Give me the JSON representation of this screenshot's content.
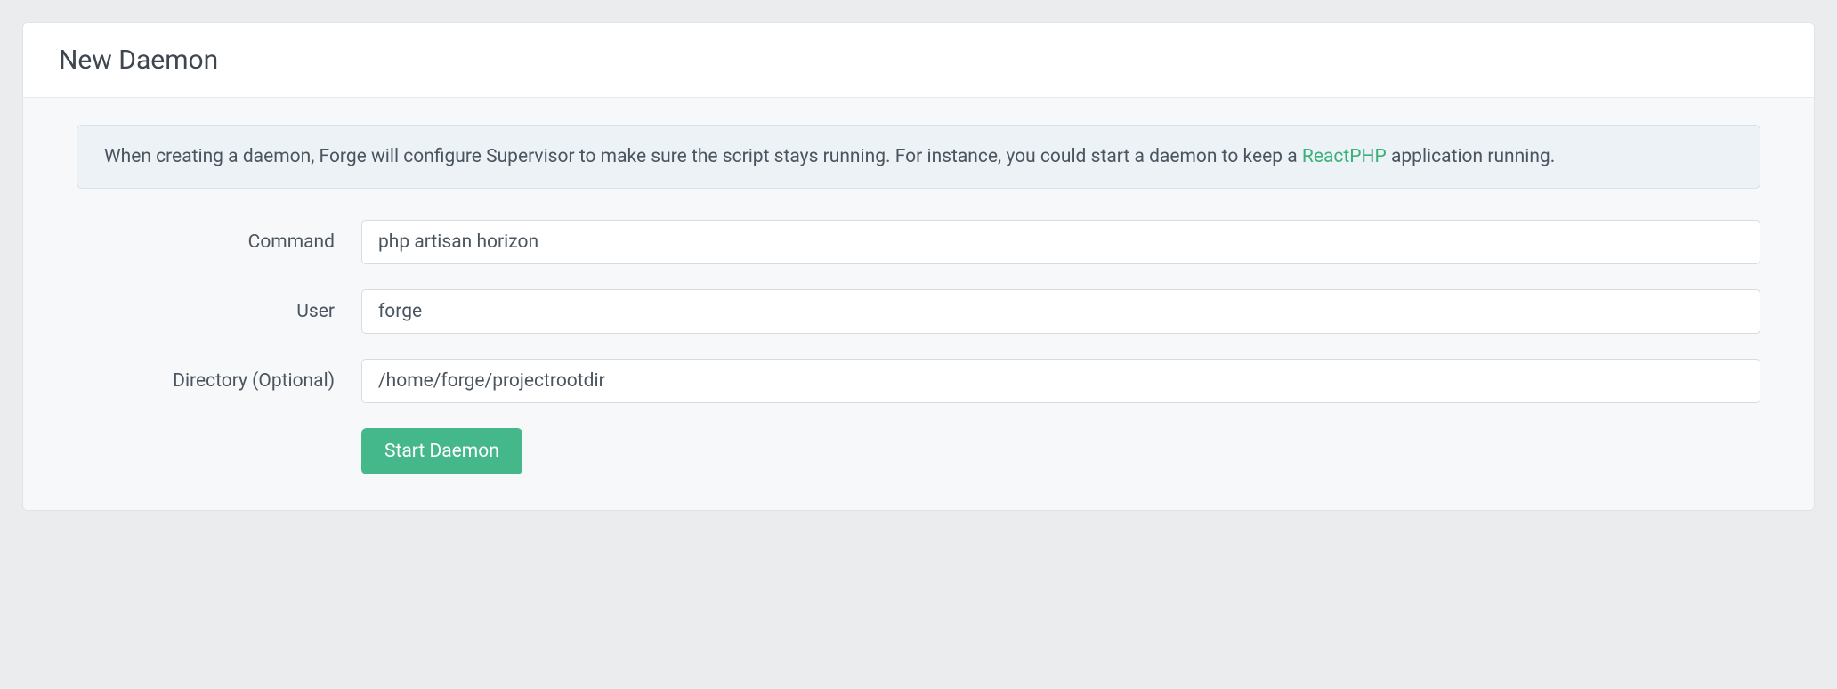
{
  "panel": {
    "title": "New Daemon"
  },
  "info": {
    "text_before_link": "When creating a daemon, Forge will configure Supervisor to make sure the script stays running. For instance, you could start a daemon to keep a ",
    "link_text": "ReactPHP",
    "text_after_link": " application running."
  },
  "form": {
    "command": {
      "label": "Command",
      "value": "php artisan horizon"
    },
    "user": {
      "label": "User",
      "value": "forge"
    },
    "directory": {
      "label": "Directory (Optional)",
      "value": "/home/forge/projectrootdir"
    },
    "submit_label": "Start Daemon"
  }
}
